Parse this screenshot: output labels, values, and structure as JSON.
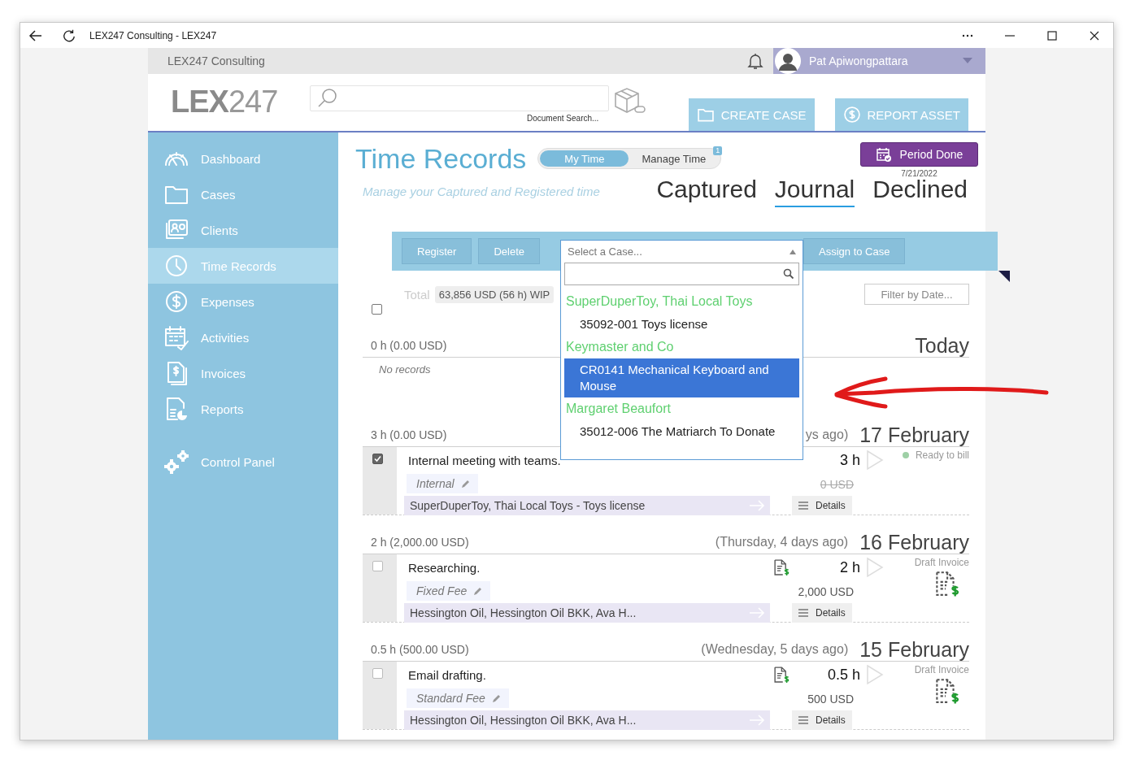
{
  "window": {
    "title": "LEX247 Consulting - LEX247"
  },
  "topbar": {
    "company": "LEX247 Consulting",
    "user": "Pat Apiwongpattara"
  },
  "header": {
    "logo_bold": "LEX",
    "logo_light": "247",
    "search_caption": "Document Search...",
    "buttons": [
      {
        "label": "CREATE CASE"
      },
      {
        "label": "REPORT ASSET"
      }
    ]
  },
  "sidebar": {
    "items": [
      {
        "label": "Dashboard",
        "selected": false
      },
      {
        "label": "Cases",
        "selected": false
      },
      {
        "label": "Clients",
        "selected": false
      },
      {
        "label": "Time Records",
        "selected": true
      },
      {
        "label": "Expenses",
        "selected": false
      },
      {
        "label": "Activities",
        "selected": false
      },
      {
        "label": "Invoices",
        "selected": false
      },
      {
        "label": "Reports",
        "selected": false
      }
    ],
    "footer_items": [
      {
        "label": "Control Panel",
        "selected": false
      }
    ]
  },
  "page": {
    "title": "Time Records",
    "modes": [
      {
        "label": "My Time",
        "selected": true
      },
      {
        "label": "Manage Time",
        "selected": false,
        "badge": "1"
      }
    ],
    "period_button": "Period Done",
    "period_date": "7/21/2022",
    "subtitle": "Manage your Captured and Registered time",
    "views": [
      {
        "label": "Captured",
        "selected": false
      },
      {
        "label": "Journal",
        "selected": true
      },
      {
        "label": "Declined",
        "selected": false
      }
    ]
  },
  "toolbar": {
    "buttons": [
      "Register",
      "Delete"
    ],
    "case_select": {
      "placeholder": "Select a Case...",
      "expanded": true,
      "groups": [
        {
          "client": "SuperDuperToy, Thai Local Toys",
          "cases": [
            {
              "label": "35092-001 Toys license",
              "selected": false
            }
          ]
        },
        {
          "client": "Keymaster and Co",
          "cases": [
            {
              "label": "CR0141 Mechanical Keyboard and Mouse",
              "selected": true
            }
          ]
        },
        {
          "client": "Margaret Beaufort",
          "cases": [
            {
              "label": "35012-006 The Matriarch To Donate",
              "selected": false
            }
          ]
        }
      ]
    },
    "assign_button": "Assign to Case"
  },
  "summary": {
    "label": "Total",
    "value": "63,856 USD (56 h)",
    "tag": "WIP",
    "filter_placeholder": "Filter by Date...",
    "select_all_checked": false
  },
  "groups": [
    {
      "total": "0 h",
      "amount": "(0.00 USD)",
      "date": "Today",
      "empty_text": "No records"
    },
    {
      "total": "3 h",
      "amount": "(0.00 USD)",
      "day": "ys ago)",
      "date": "17 February",
      "records": [
        {
          "checked": true,
          "description": "Internal meeting with teams.",
          "fee": "Internal",
          "case": "SuperDuperToy, Thai Local Toys - Toys license",
          "hours": "3 h",
          "amount": "0 USD",
          "struck": true,
          "invoice_icon": false,
          "status": "Ready to bill",
          "kind": "ready",
          "details": "Details"
        }
      ]
    },
    {
      "total": "2 h",
      "amount": "(2,000.00 USD)",
      "day": "(Thursday, 4 days ago)",
      "date": "16 February",
      "records": [
        {
          "checked": false,
          "description": "Researching.",
          "fee": "Fixed Fee",
          "case": "Hessington Oil, Hessington Oil BKK, Ava H...",
          "hours": "2 h",
          "amount": "2,000 USD",
          "struck": false,
          "invoice_icon": true,
          "status": "Draft Invoice",
          "kind": "draft",
          "details": "Details"
        }
      ]
    },
    {
      "total": "0.5 h",
      "amount": "(500.00 USD)",
      "day": "(Wednesday, 5 days ago)",
      "date": "15 February",
      "records": [
        {
          "checked": false,
          "description": "Email drafting.",
          "fee": "Standard Fee",
          "case": "Hessington Oil, Hessington Oil BKK, Ava H...",
          "hours": "0.5 h",
          "amount": "500 USD",
          "struck": false,
          "invoice_icon": true,
          "status": "Draft Invoice",
          "kind": "draft",
          "details": "Details"
        }
      ]
    }
  ]
}
